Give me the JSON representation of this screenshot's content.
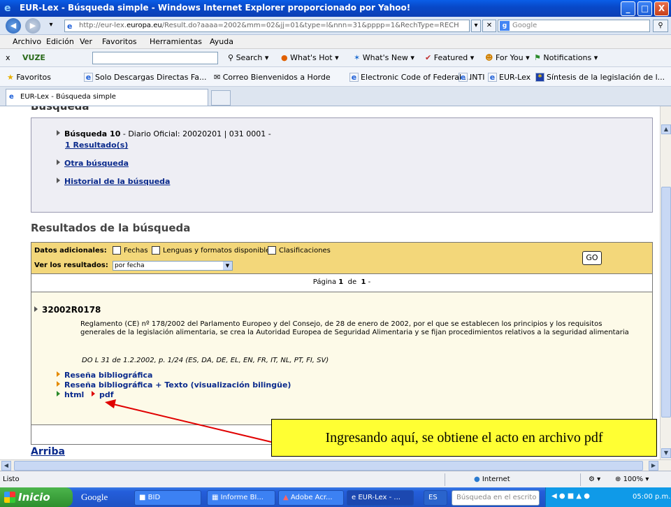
{
  "window": {
    "title": "EUR-Lex - Búsqueda simple - Windows Internet Explorer proporcionado por Yahoo!",
    "minimize": "_",
    "maximize": "□",
    "close": "X"
  },
  "address_bar": {
    "url_prefix": "http://eur-lex.",
    "url_domain": "europa.eu",
    "url_rest": "/Result.do?aaaa=2002&mm=02&jj=01&type=l&nnn=31&pppp=1&RechType=RECH",
    "search_placeholder": "Google"
  },
  "menu": [
    "Archivo",
    "Edición",
    "Ver",
    "Favoritos",
    "Herramientas",
    "Ayuda"
  ],
  "vuze_toolbar": {
    "brand": "VUZE",
    "items": [
      "Search",
      "What's Hot",
      "What's New",
      "Featured",
      "For You",
      "Notifications"
    ]
  },
  "favorites_bar": {
    "label": "Favoritos",
    "items": [
      "Solo Descargas Directas Fa...",
      "Correo Bienvenidos a Horde",
      "Electronic Code of Federal ...",
      "INTI",
      "EUR-Lex",
      "Síntesis de la legislación de l..."
    ]
  },
  "tab": {
    "label": "EUR-Lex - Búsqueda simple"
  },
  "page": {
    "heading_search": "Búsqueda",
    "search_summary_label": "Búsqueda 10",
    "search_summary_text": " - Diario Oficial: 20020201 | 031 0001 -",
    "results_count_link": "1 Resultado(s)",
    "other_search_link": "Otra búsqueda",
    "history_link": "Historial de la búsqueda",
    "heading_results": "Resultados de la búsqueda",
    "additional_data_label": "Datos adicionales:",
    "checkbox_dates": "Fechas",
    "checkbox_languages": "Lenguas y formatos disponibles",
    "checkbox_classifications": "Clasificaciones",
    "view_results_label": "Ver los resultados:",
    "view_results_value": "por fecha",
    "go_button": "GO",
    "pagination_prefix": "Página",
    "pagination_current": "1",
    "pagination_of": "de",
    "pagination_total": "1",
    "pagination_suffix": "-",
    "result_celex": "32002R0178",
    "result_description": "Reglamento (CE) nº 178/2002 del Parlamento Europeo y del Consejo, de 28 de enero de 2002, por el que se establecen los principios y los requisitos generales de la legislación alimentaria, se crea la Autoridad Europea de Seguridad Alimentaria y se fijan procedimientos relativos a la seguridad alimentaria",
    "result_oj_reference": "DO L 31 de 1.2.2002, p. 1/24 (ES, DA, DE, EL, EN, FR, IT, NL, PT, FI, SV)",
    "link_bibliographic": "Reseña bibliográfica",
    "link_bibliographic_text": "Reseña bibliográfica + Texto (visualización bilingüe)",
    "link_html": "html",
    "link_pdf": "pdf",
    "link_top": "Arriba"
  },
  "annotation": {
    "callout_text": "Ingresando aquí, se obtiene el acto en archivo pdf",
    "arrow_color": "#e00000",
    "callout_bg": "#ffff33"
  },
  "status_bar": {
    "status": "Listo",
    "zone": "Internet",
    "zoom": "100%"
  },
  "taskbar": {
    "start": "Inicio",
    "google": "Google",
    "tasks": [
      "BID",
      "Informe BI...",
      "Adobe Acr...",
      "EUR-Lex - ..."
    ],
    "language": "ES",
    "search_placeholder": "Búsqueda en el escrito",
    "clock": "05:00 p.m."
  },
  "colors": {
    "accent_blue": "#0a5ee8",
    "search_box_bg": "#eeeef4",
    "filter_bar_bg": "#f3d77a",
    "result_bg": "#fdfae8",
    "link_color": "#0a2a8c"
  }
}
